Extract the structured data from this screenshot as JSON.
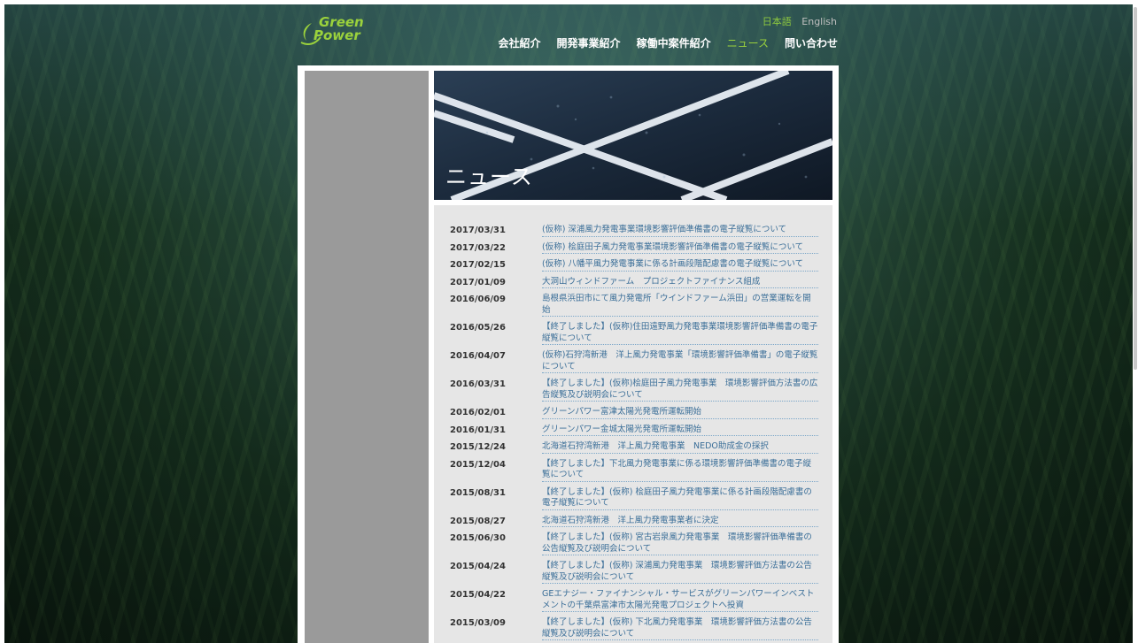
{
  "logo": {
    "line1": "Green",
    "line2": "Power"
  },
  "language": {
    "japanese": "日本語",
    "english": "English"
  },
  "nav": [
    {
      "label": "会社紹介",
      "active": false
    },
    {
      "label": "開発事業紹介",
      "active": false
    },
    {
      "label": "稼働中案件紹介",
      "active": false
    },
    {
      "label": "ニュース",
      "active": true
    },
    {
      "label": "問い合わせ",
      "active": false
    }
  ],
  "page_title": "ニュース",
  "news": [
    {
      "date": "2017/03/31",
      "title": "(仮称) 深浦風力発電事業環境影響評価準備書の電子縦覧について"
    },
    {
      "date": "2017/03/22",
      "title": "(仮称) 桧庭田子風力発電事業環境影響評価準備書の電子縦覧について"
    },
    {
      "date": "2017/02/15",
      "title": "(仮称) 八幡平風力発電事業に係る計画段階配慮書の電子縦覧について"
    },
    {
      "date": "2017/01/09",
      "title": "大洞山ウィンドファーム　プロジェクトファイナンス組成"
    },
    {
      "date": "2016/06/09",
      "title": "島根県浜田市にて風力発電所「ウインドファーム浜田」の営業運転を開始"
    },
    {
      "date": "2016/05/26",
      "title": "【終了しました】(仮称)住田遠野風力発電事業環境影響評価準備書の電子縦覧について"
    },
    {
      "date": "2016/04/07",
      "title": "(仮称)石狩湾新港　洋上風力発電事業「環境影響評価準備書」の電子縦覧について"
    },
    {
      "date": "2016/03/31",
      "title": "【終了しました】(仮称)桧庭田子風力発電事業　環境影響評価方法書の広告縦覧及び説明会について"
    },
    {
      "date": "2016/02/01",
      "title": "グリーンパワー富津太陽光発電所運転開始"
    },
    {
      "date": "2016/01/31",
      "title": "グリーンパワー金城太陽光発電所運転開始"
    },
    {
      "date": "2015/12/24",
      "title": "北海道石狩湾新港　洋上風力発電事業　NEDO助成金の採択"
    },
    {
      "date": "2015/12/04",
      "title": "【終了しました】下北風力発電事業に係る環境影響評価準備書の電子縦覧について"
    },
    {
      "date": "2015/08/31",
      "title": "【終了しました】(仮称) 桧庭田子風力発電事業に係る計画段階配慮書の電子縦覧について"
    },
    {
      "date": "2015/08/27",
      "title": "北海道石狩湾新港　洋上風力発電事業者に決定"
    },
    {
      "date": "2015/06/30",
      "title": "【終了しました】(仮称) 宮古岩泉風力発電事業　環境影響評価準備書の公告縦覧及び説明会について"
    },
    {
      "date": "2015/04/24",
      "title": "【終了しました】(仮称) 深浦風力発電事業　環境影響評価方法書の公告縦覧及び説明会について"
    },
    {
      "date": "2015/04/22",
      "title": "GEエナジー・ファイナンシャル・サービスがグリーンパワーインベストメントの千葉県富津市太陽光発電プロジェクトへ投資"
    },
    {
      "date": "2015/03/09",
      "title": "【終了しました】(仮称) 下北風力発電事業　環境影響評価方法書の公告縦覧及び説明会について"
    }
  ],
  "colors": {
    "accent": "#9bd23c",
    "link": "#3a6e98",
    "sidebar": "#9a9a9a",
    "news_bg": "#e6e6e6"
  }
}
